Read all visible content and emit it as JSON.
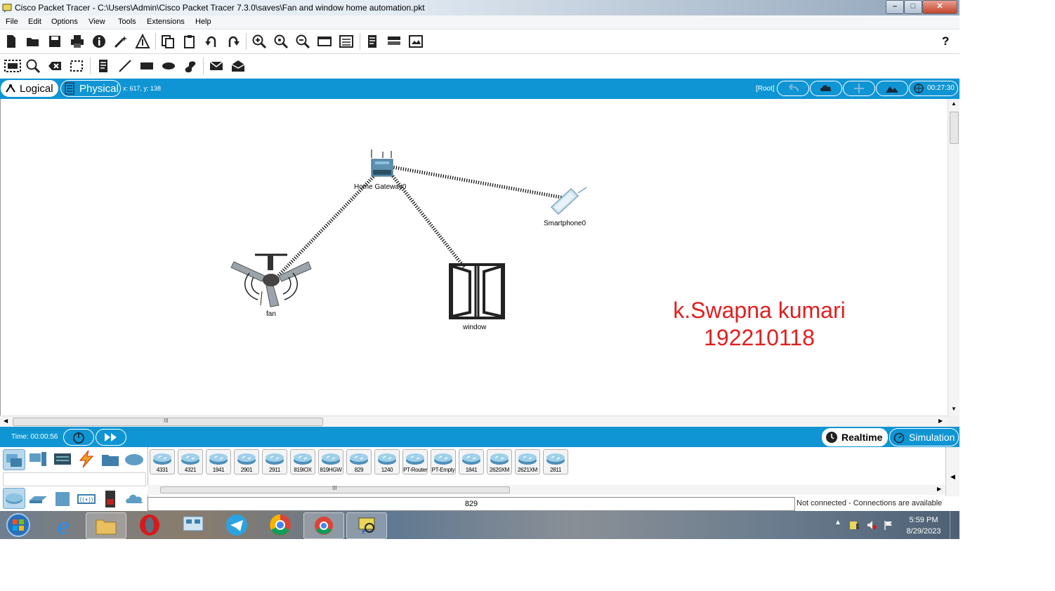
{
  "window": {
    "title": "Cisco Packet Tracer - C:\\Users\\Admin\\Cisco Packet Tracer 7.3.0\\saves\\Fan and window home automation.pkt"
  },
  "menu": [
    "File",
    "Edit",
    "Options",
    "View",
    "Tools",
    "Extensions",
    "Help"
  ],
  "toolbar": {
    "help_label": "?"
  },
  "workspace": {
    "logical_label": "Logical",
    "physical_label": "Physical",
    "coords": "x: 617, y: 138",
    "root_label": "[Root]",
    "clock": "00:27:30"
  },
  "canvas": {
    "devices": [
      {
        "name": "Home Gateway0"
      },
      {
        "name": "Smartphone0"
      },
      {
        "name": "fan"
      },
      {
        "name": "window"
      }
    ],
    "annotation": {
      "line1": "k.Swapna kumari",
      "line2": "192210118"
    }
  },
  "hscroll_marker": "III",
  "timebar": {
    "time": "Time: 00:00:56",
    "realtime_label": "Realtime",
    "simulation_label": "Simulation"
  },
  "device_list": [
    "4331",
    "4321",
    "1941",
    "2901",
    "2911",
    "819IOX",
    "819HGW",
    "829",
    "1240",
    "PT-Router",
    "PT-Empty",
    "1841",
    "2620XM",
    "2621XM",
    "2811"
  ],
  "device_scroll_marker": "III",
  "status": {
    "selected_device": "829",
    "connection": "Not connected - Connections are available"
  },
  "taskbar": {
    "time": "5:59 PM",
    "date": "8/29/2023"
  },
  "colors": {
    "accent_blue": "#0f95d4",
    "annotation_red": "#e02020"
  }
}
